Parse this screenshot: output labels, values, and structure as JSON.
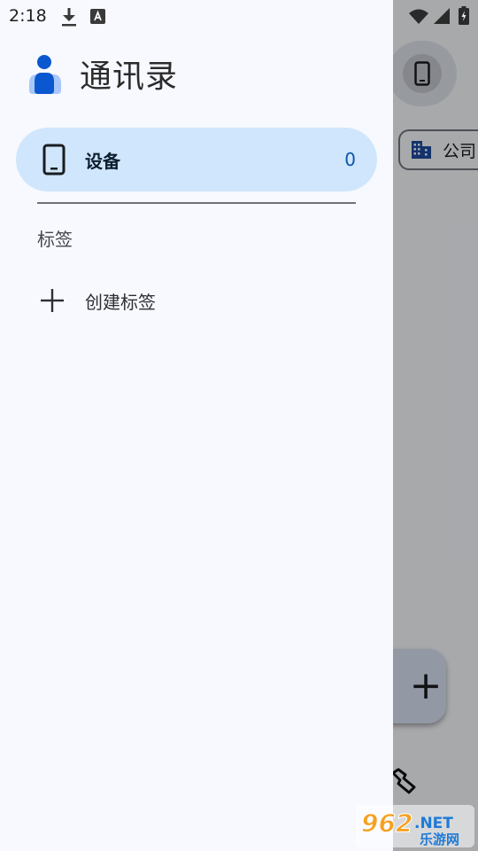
{
  "status_bar": {
    "time": "2:18",
    "left_icons": [
      "download-icon",
      "font-a-icon"
    ],
    "right_icons": [
      "wifi-icon",
      "signal-icon",
      "battery-icon"
    ]
  },
  "drawer": {
    "app_title": "通讯录",
    "nav_items": [
      {
        "label": "设备",
        "count": "0",
        "icon": "phone-icon",
        "selected": true
      }
    ],
    "section_label": "标签",
    "create_label": "创建标签"
  },
  "background": {
    "chip_label": "公司",
    "chip_icon": "building-icon",
    "fab_icon": "plus-icon",
    "bottom_icon": "wrench-icon"
  },
  "watermark": {
    "number": "962",
    "suffix": ".NET",
    "chinese": "乐游网"
  },
  "colors": {
    "drawer_bg": "#f7f9fe",
    "selected_bg": "#cfe6fc",
    "accent": "#0b57d0",
    "count_color": "#0a57a8"
  }
}
